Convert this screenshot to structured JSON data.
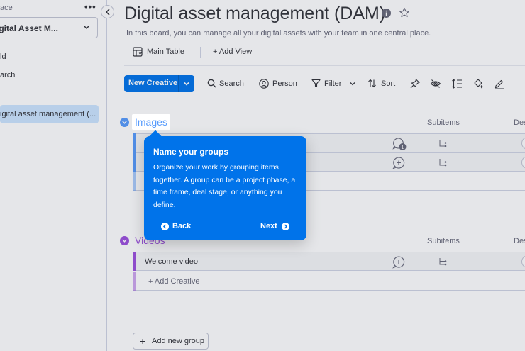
{
  "sidebar": {
    "workspace_label": "ace",
    "more_label": "•••",
    "workspace_name": "igital Asset M...",
    "links": [
      "ld",
      "arch"
    ],
    "board_item": "igital asset management (..."
  },
  "header": {
    "title": "Digital asset management (DAM)",
    "description": "In this board, you can manage all your digital assets with your team in one central place."
  },
  "tabs": {
    "main": "Main Table",
    "add": "+  Add View"
  },
  "toolbar": {
    "new_label": "New Creative",
    "search": "Search",
    "person": "Person",
    "filter": "Filter",
    "sort": "Sort"
  },
  "columns": {
    "subitems": "Subitems",
    "desc_partial": "Des"
  },
  "groups": [
    {
      "title": "Images",
      "color": "#579bfc",
      "rows": [
        {
          "name": "",
          "update_count": "1"
        },
        {
          "name": ""
        }
      ]
    },
    {
      "title": "Videos",
      "color": "#9d50dd",
      "rows": [
        {
          "name": "Welcome video"
        }
      ],
      "add_label": "+ Add Creative"
    }
  ],
  "add_group_label": "Add new group",
  "tooltip": {
    "title": "Name your groups",
    "body": "Organize your work by grouping items together. A group can be a project phase, a time frame, deal stage, or anything you define.",
    "back": "Back",
    "next": "Next"
  },
  "colors": {
    "primary": "#0073ea",
    "images_group": "#579bfc",
    "videos_group": "#9d50dd"
  }
}
